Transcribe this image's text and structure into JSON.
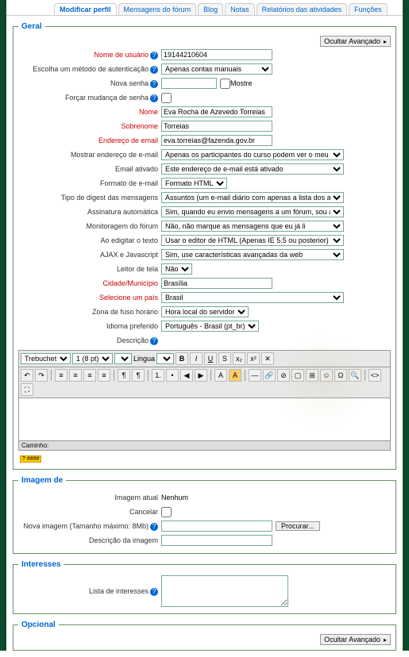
{
  "tabs": [
    "Modificar perfil",
    "Mensagens do fórum",
    "Blog",
    "Notas",
    "Relatórios das atividades",
    "Funções"
  ],
  "activeTab": 0,
  "sections": {
    "geral": "Geral",
    "imagem": "Imagem de",
    "interesses": "Interesses",
    "opcional": "Opcional"
  },
  "advButton": "Ocultar Avançado",
  "labels": {
    "username": "Nome de usuário",
    "authmethod": "Escolha um método de autenticação",
    "newpass": "Nova senha",
    "forcepass": "Forçar mudança de senha",
    "name": "Nome",
    "surname": "Sobrenome",
    "email": "Endereço de email",
    "showemail": "Mostrar endereço de e-mail",
    "emailactive": "Email ativado",
    "emailformat": "Formato de e-mail",
    "digest": "Tipo de digest das mensagens",
    "autosub": "Assinatura automática",
    "forumtrack": "Monitoragem do fórum",
    "editor": "Ao edigitar o texto",
    "ajax": "AJAX e Javascript",
    "screenreader": "Leitor de tela",
    "city": "Cidade/Município",
    "country": "Selecione um país",
    "timezone": "Zona de fuso horário",
    "lang": "Idioma preferido",
    "desc": "Descrição",
    "curimg": "Imagem atual",
    "cancel": "Cancelar",
    "newimg": "Nova imagem (Tamanho máximo: 8Mb)",
    "imgdesc": "Descrição da imagem",
    "interests": "Lista de interesses"
  },
  "values": {
    "username": "19144210604",
    "name": "Eva Rocha de Azevedo Torreias",
    "surname": "Torreias",
    "email": "eva.torreias@fazenda.gov.br",
    "city": "Brasília",
    "curimg": "Nenhum",
    "mostre": "Mostre"
  },
  "selects": {
    "authmethod": "Apenas contas manuais",
    "showemail": "Apenas os participantes do curso podem ver o meu endereço de e-mail",
    "emailactive": "Este endereço de e-mail está ativado",
    "emailformat": "Formato HTML",
    "digest": "Assuntos (um e-mail diário com apenas a lista dos assuntos das mensagens)",
    "autosub": "Sim, quando eu envio mensagens a um fórum, sou automaticamente assinante",
    "forumtrack": "Não, não marque as mensagens que eu já li",
    "editor": "Usar o editor de HTML (Apenas IE 5.5 ou posterior)",
    "ajax": "Sim, use características avançadas da web",
    "screenreader": "Não",
    "country": "Brasil",
    "timezone": "Hora local do servidor",
    "lang": "Português - Brasil (pt_br)"
  },
  "editor": {
    "font": "Trebuchet",
    "size": "1 (8 pt)",
    "langLabel": "Lingua",
    "path": "Caminho:",
    "badge": "? ####"
  },
  "browse": "Procurar..."
}
